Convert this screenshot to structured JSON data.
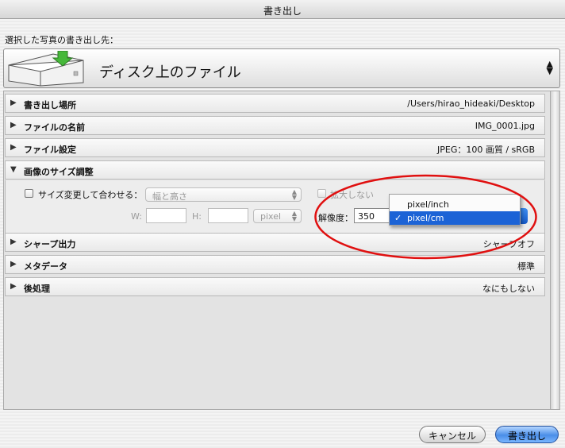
{
  "window": {
    "title": "書き出し"
  },
  "header": {
    "section_label": "選択した写真の書き出し先："
  },
  "destination": {
    "label": "ディスク上のファイル",
    "icon": "disk-export-icon"
  },
  "sections": [
    {
      "title": "書き出し場所",
      "value": "/Users/hirao_hideaki/Desktop",
      "expanded": false
    },
    {
      "title": "ファイルの名前",
      "value": "IMG_0001.jpg",
      "expanded": false
    },
    {
      "title": "ファイル設定",
      "value": "JPEG：100 画質 / sRGB",
      "expanded": false
    },
    {
      "title": "画像のサイズ調整",
      "value": "",
      "expanded": true
    },
    {
      "title": "シャープ出力",
      "value": "シャープオフ",
      "expanded": false
    },
    {
      "title": "メタデータ",
      "value": "標準",
      "expanded": false
    },
    {
      "title": "後処理",
      "value": "なにもしない",
      "expanded": false
    }
  ],
  "resize": {
    "fit_label": "サイズ変更して合わせる：",
    "fit_checked": false,
    "fit_option": "幅と高さ",
    "no_enlarge_label": "拡大しない",
    "w_label": "W:",
    "h_label": "H:",
    "w_value": "",
    "h_value": "",
    "unit_option": "pixel",
    "resolution_label": "解像度：",
    "resolution_value": "350"
  },
  "resolution_menu": {
    "options": [
      "pixel/inch",
      "pixel/cm"
    ],
    "selected": "pixel/cm",
    "check": "✓"
  },
  "buttons": {
    "cancel": "キャンセル",
    "export": "書き出し"
  },
  "colors": {
    "highlight": "#1c63d6",
    "annotation_circle": "#e01010"
  }
}
